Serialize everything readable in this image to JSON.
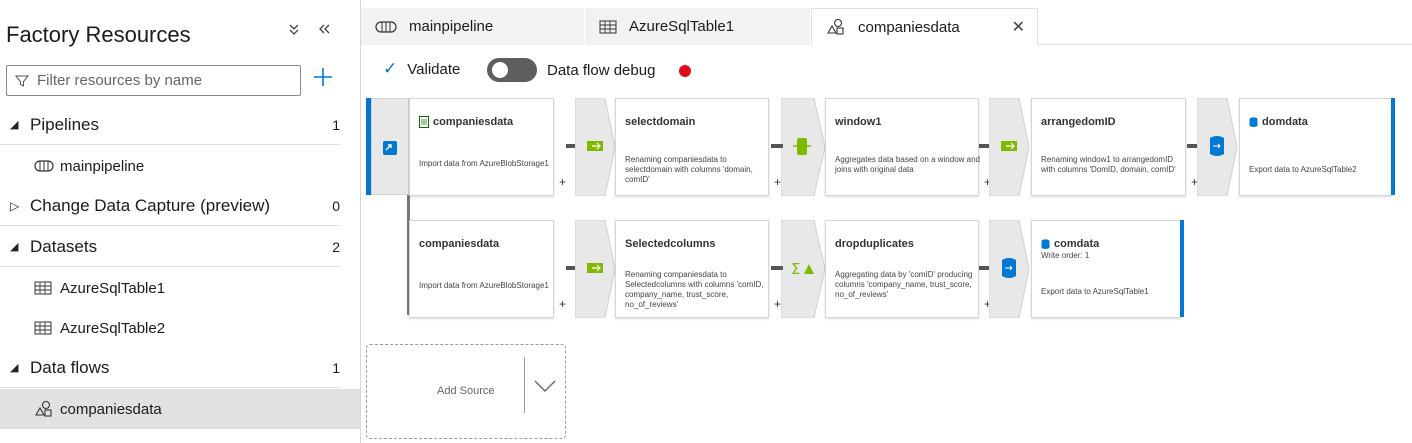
{
  "sidebar": {
    "title": "Factory Resources",
    "filter_placeholder": "Filter resources by name",
    "sections": [
      {
        "label": "Pipelines",
        "count": "1"
      },
      {
        "label": "Change Data Capture (preview)",
        "count": "0"
      },
      {
        "label": "Datasets",
        "count": "2"
      },
      {
        "label": "Data flows",
        "count": "1"
      }
    ],
    "items": {
      "pipeline": "mainpipeline",
      "dataset1": "AzureSqlTable1",
      "dataset2": "AzureSqlTable2",
      "dataflow": "companiesdata"
    }
  },
  "tabs": [
    {
      "label": "mainpipeline",
      "icon": "pipeline-icon"
    },
    {
      "label": "AzureSqlTable1",
      "icon": "table-icon"
    },
    {
      "label": "companiesdata",
      "icon": "dataflow-icon"
    }
  ],
  "toolbar": {
    "validate": "Validate",
    "debug_label": "Data flow debug",
    "debug_on": false,
    "debug_status_color": "#e00b1c"
  },
  "flow": {
    "stream1": [
      {
        "title": "companiesdata",
        "desc": "Import data from AzureBlobStorage1",
        "icon": "source-file-icon"
      },
      {
        "title": "selectdomain",
        "desc": "Renaming companiesdata to selectdomain with columns 'domain, comID'",
        "icon": "select-icon"
      },
      {
        "title": "window1",
        "desc": "Aggregates data based on a window and joins with original data",
        "icon": "window-icon"
      },
      {
        "title": "arrangedomID",
        "desc": "Renaming window1 to arrangedomID with columns 'DomID, domain, comID'",
        "icon": "select-icon"
      },
      {
        "title": "domdata",
        "desc": "Export data to AzureSqlTable2",
        "icon": "sink-icon"
      }
    ],
    "stream2": [
      {
        "title": "companiesdata",
        "desc": "Import data from AzureBlobStorage1"
      },
      {
        "title": "Selectedcolumns",
        "desc": "Renaming companiesdata to Selectedcolumns with columns 'comID, company_name, trust_score, no_of_reviews'",
        "icon": "select-icon"
      },
      {
        "title": "dropduplicates",
        "desc": "Aggregating data by 'comID' producing columns 'company_name, trust_score, no_of_reviews'",
        "icon": "aggregate-icon"
      },
      {
        "title": "comdata",
        "write_order": "Write order: 1",
        "desc": "Export data to AzureSqlTable1",
        "icon": "sink-icon"
      }
    ],
    "add_source": "Add Source"
  },
  "colors": {
    "accent": "#0078d4",
    "transform_green": "#7fba00"
  }
}
